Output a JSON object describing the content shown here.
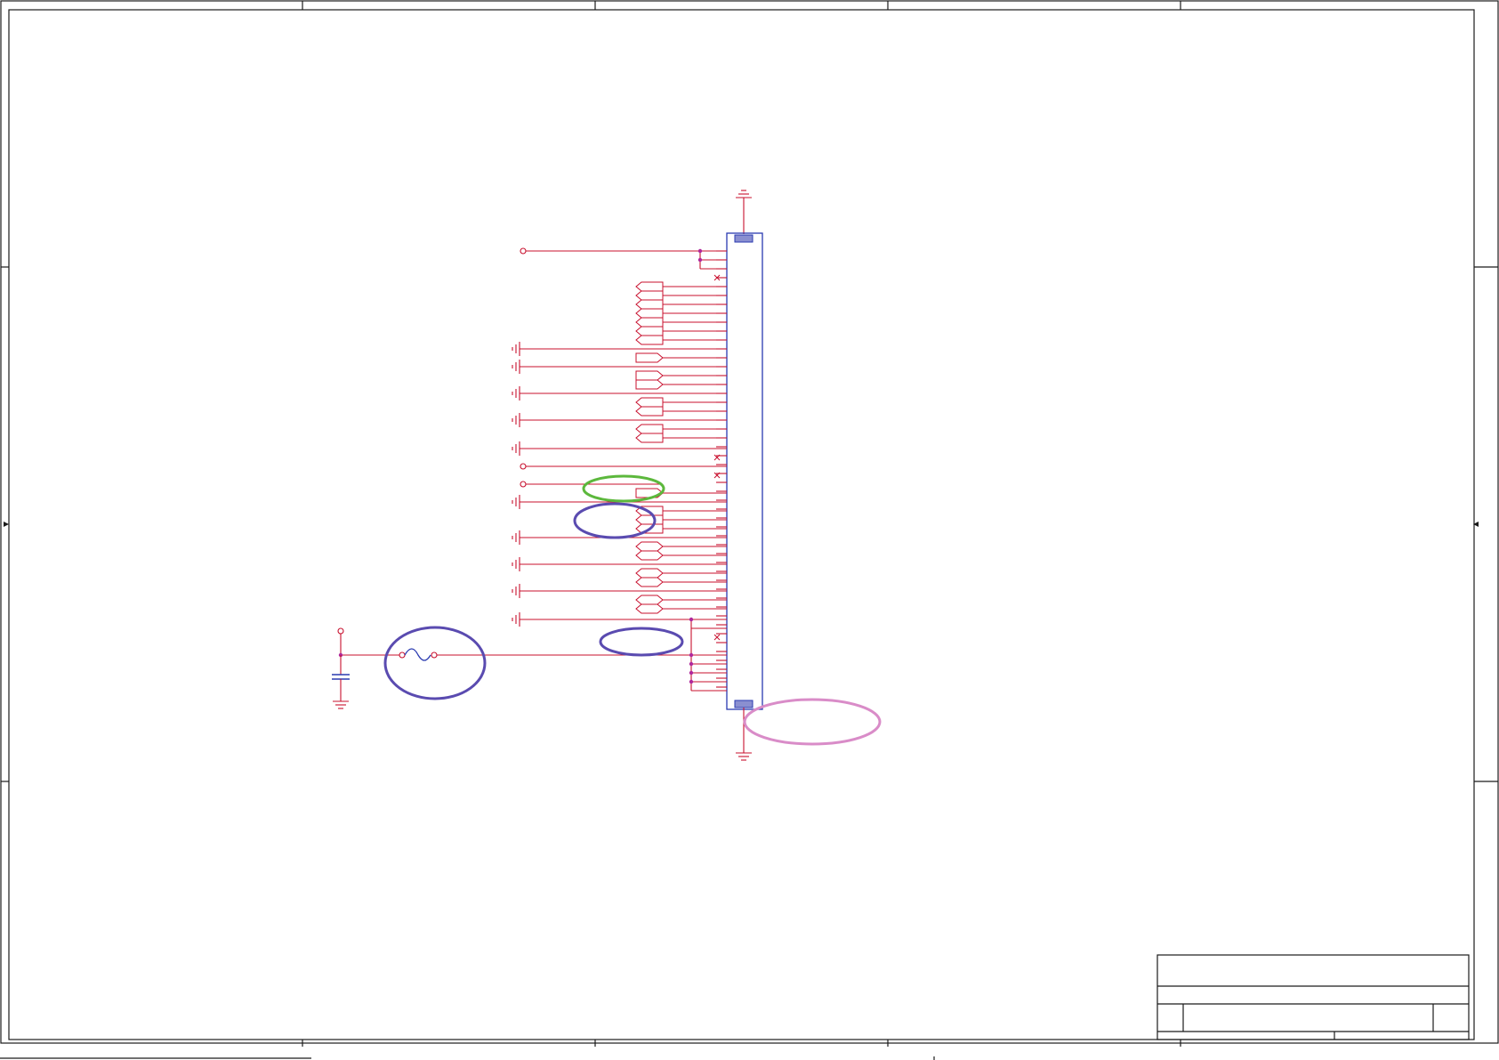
{
  "sheet": {
    "border_color": "#1a1a1a",
    "wire_color": "#c8102e",
    "component_color": "#2a3ab0",
    "junction_color": "#b0289c"
  },
  "annotations": [
    {
      "name": "green-highlight-ellipse",
      "color": "#5cb83c"
    },
    {
      "name": "purple-highlight-ellipse-1",
      "color": "#5a4bb0"
    },
    {
      "name": "purple-highlight-ellipse-2",
      "color": "#5a4bb0"
    },
    {
      "name": "purple-highlight-ellipse-3",
      "color": "#5a4bb0"
    },
    {
      "name": "pink-highlight-ellipse",
      "color": "#d98cc8"
    }
  ],
  "icons": [
    "ground-icon",
    "capacitor-icon",
    "fuse-icon",
    "off-page-port-icon",
    "pad-icon"
  ],
  "title_block": {
    "title": "",
    "document": "",
    "revision": ""
  }
}
